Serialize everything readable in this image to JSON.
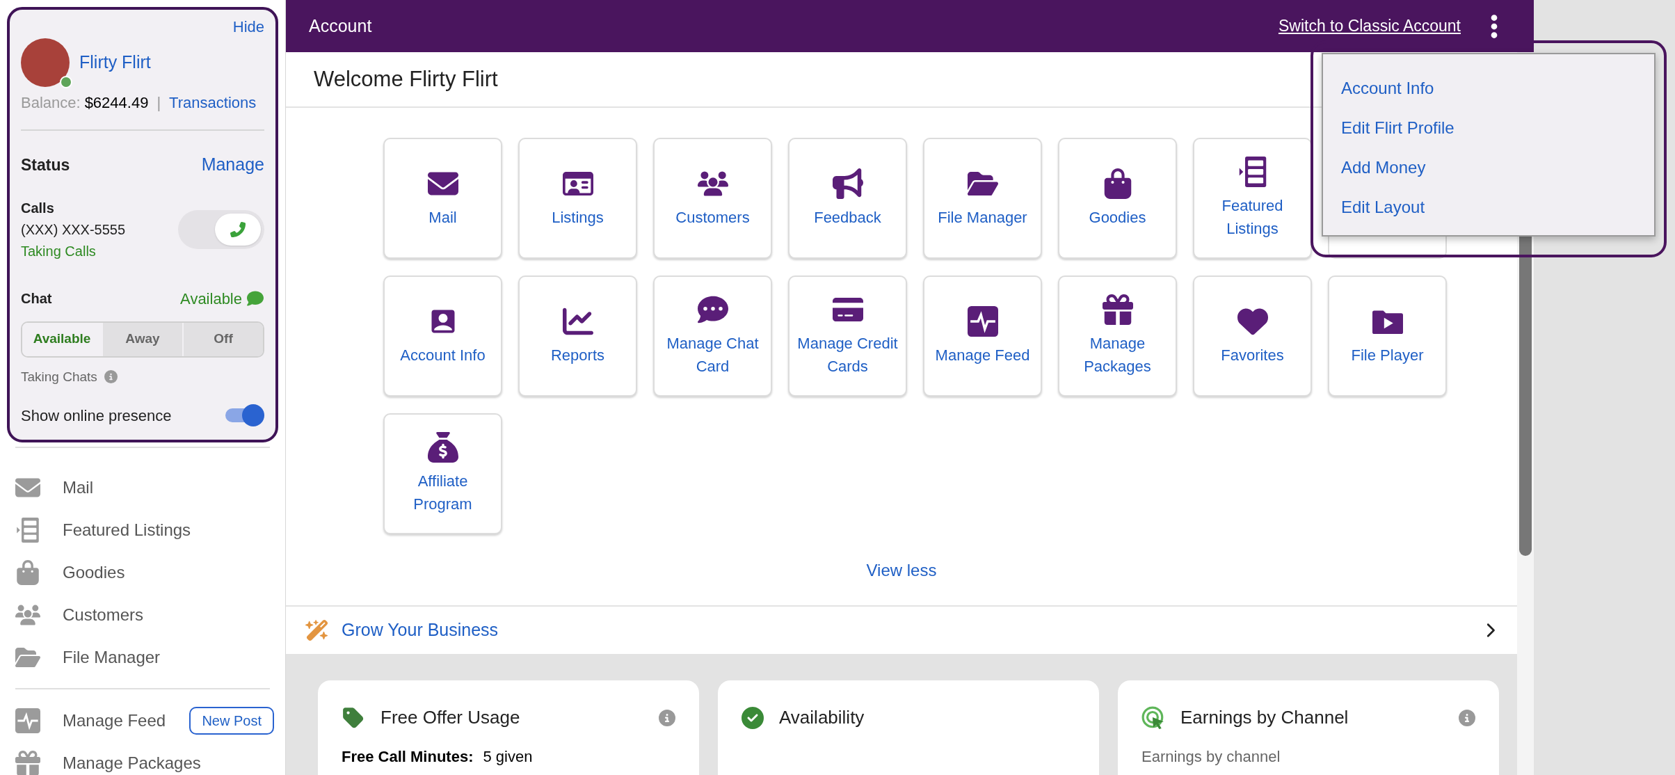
{
  "sidebar": {
    "profile": {
      "hide": "Hide",
      "name": "Flirty Flirt",
      "online": true,
      "balance_label": "Balance:",
      "balance": "$6244.49",
      "separator": "|",
      "transactions": "Transactions"
    },
    "status": {
      "title": "Status",
      "manage": "Manage",
      "calls": {
        "label": "Calls",
        "phone": "(XXX) XXX-5555",
        "state": "Taking Calls",
        "on": true
      },
      "chat": {
        "label": "Chat",
        "state": "Available",
        "note": "Taking Chats",
        "options": [
          {
            "label": "Available",
            "selected": true
          },
          {
            "label": "Away",
            "selected": false
          },
          {
            "label": "Off",
            "selected": false
          }
        ]
      },
      "presence": {
        "label": "Show online presence",
        "on": true
      }
    },
    "menu": [
      [
        {
          "label": "Mail"
        },
        {
          "label": "Featured Listings"
        },
        {
          "label": "Goodies"
        },
        {
          "label": "Customers"
        },
        {
          "label": "File Manager"
        }
      ],
      [
        {
          "label": "Manage Feed",
          "badge": "New Post"
        },
        {
          "label": "Manage Packages"
        }
      ]
    ]
  },
  "header": {
    "title": "Account",
    "switch_link": "Switch to Classic Account"
  },
  "dropdown": {
    "items": [
      "Account Info",
      "Edit Flirt Profile",
      "Add Money",
      "Edit Layout"
    ]
  },
  "welcome": "Welcome Flirty Flirt",
  "tiles": [
    {
      "kind": "tile",
      "label": "Mail"
    },
    {
      "kind": "tile",
      "label": "Listings"
    },
    {
      "kind": "tile",
      "label": "Customers"
    },
    {
      "kind": "tile",
      "label": "Feedback"
    },
    {
      "kind": "tile",
      "label": "File Manager"
    },
    {
      "kind": "tile",
      "label": "Goodies"
    },
    {
      "kind": "tile",
      "label": "Featured Listings"
    },
    {
      "kind": "covered"
    },
    {
      "kind": "tile",
      "label": "Account Info"
    },
    {
      "kind": "tile",
      "label": "Reports"
    },
    {
      "kind": "tile",
      "label": "Manage Chat Card"
    },
    {
      "kind": "tile",
      "label": "Manage Credit Cards"
    },
    {
      "kind": "tile",
      "label": "Manage Feed"
    },
    {
      "kind": "tile",
      "label": "Manage Packages"
    },
    {
      "kind": "tile",
      "label": "Favorites"
    },
    {
      "kind": "tile",
      "label": "File Player"
    },
    {
      "kind": "tile",
      "label": "Affiliate Program"
    }
  ],
  "view_less": "View less",
  "grow": "Grow Your Business",
  "cards": [
    {
      "title": "Free Offer Usage",
      "info": true,
      "body_label": "Free Call Minutes:",
      "body_value": "5 given"
    },
    {
      "title": "Availability",
      "info": false
    },
    {
      "title": "Earnings by Channel",
      "info": true,
      "body_label": "Earnings by channel"
    }
  ]
}
